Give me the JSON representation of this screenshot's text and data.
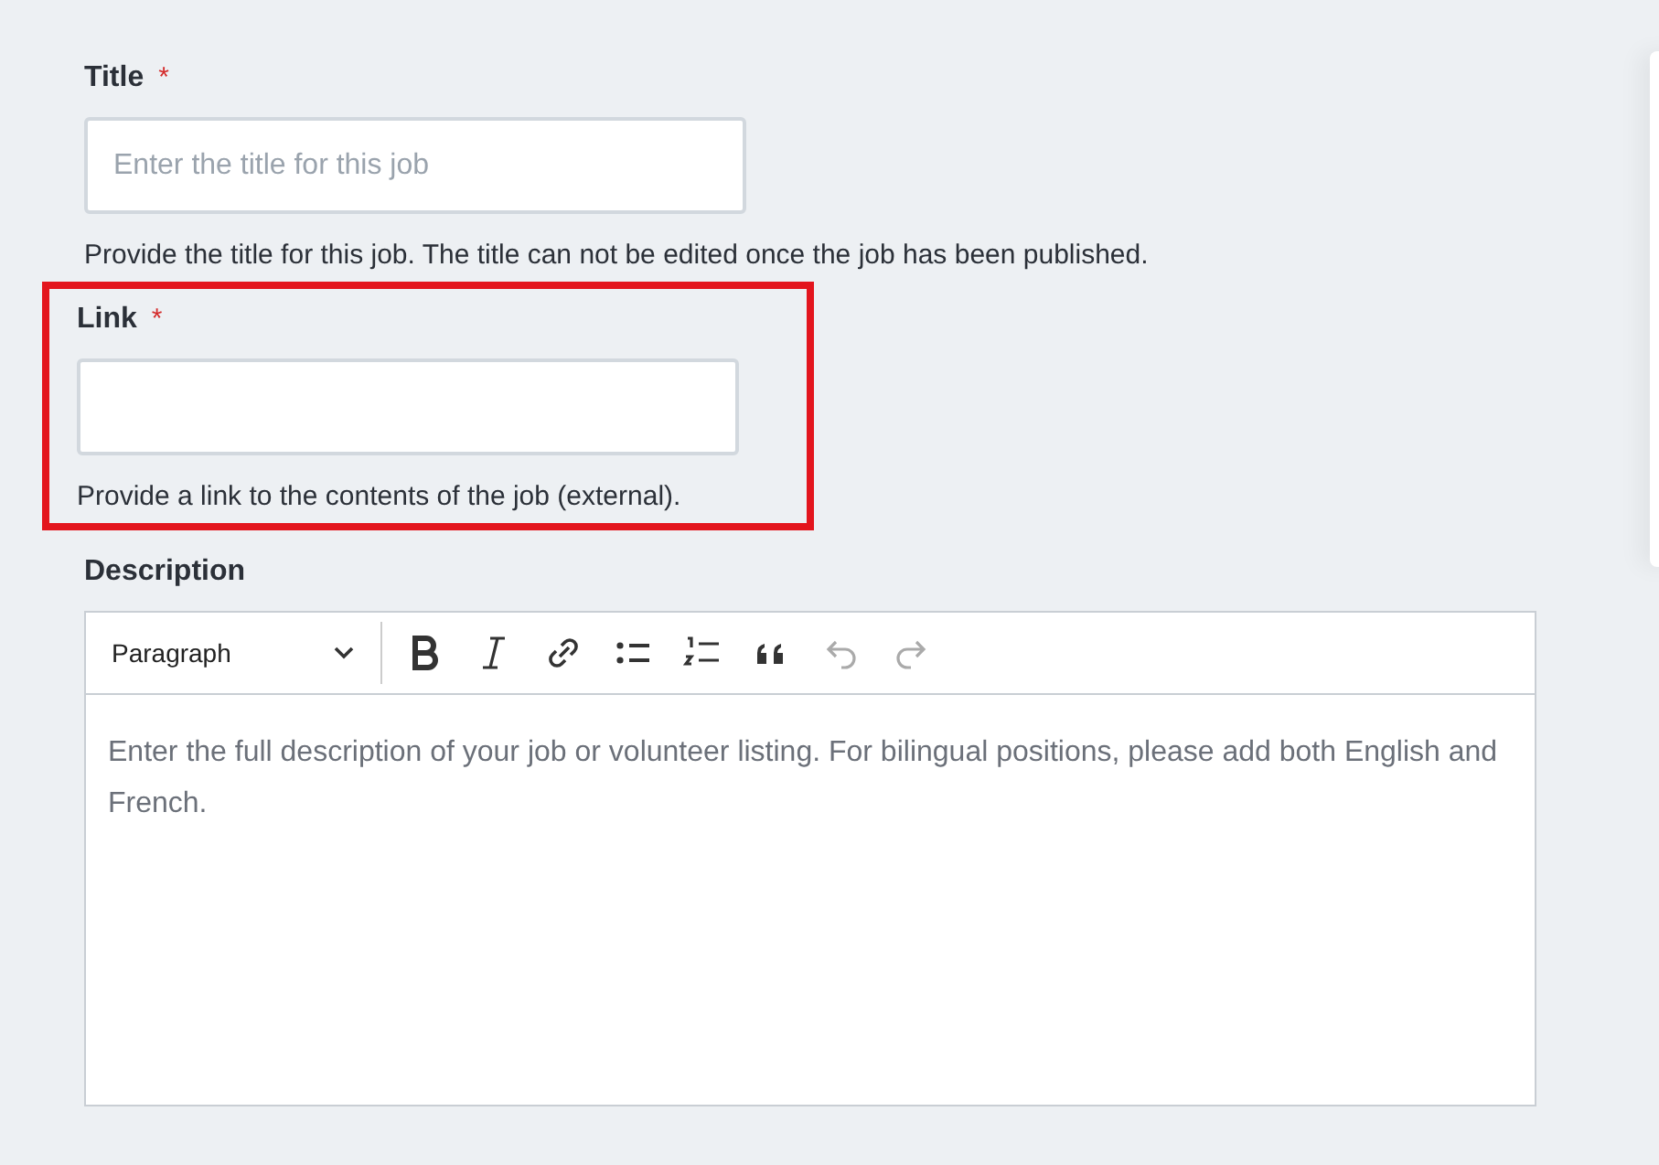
{
  "fields": [
    {
      "label": "Title",
      "required": true,
      "placeholder": "Enter the title for this job",
      "help": "Provide the title for this job. The title can not be edited once the job has been published.",
      "highlighted": false
    },
    {
      "label": "Link",
      "required": true,
      "help": "Provide a link to the contents of the job (external).",
      "highlighted": true
    }
  ],
  "required_mark": "*",
  "description": {
    "label": "Description",
    "format": "Paragraph",
    "tools": [
      {
        "kind": "bold",
        "disabled": false
      },
      {
        "kind": "italic",
        "disabled": false
      },
      {
        "kind": "link",
        "disabled": false
      },
      {
        "kind": "bullets",
        "disabled": false
      },
      {
        "kind": "numbers",
        "disabled": false
      },
      {
        "kind": "quote",
        "disabled": false
      },
      {
        "kind": "undo",
        "disabled": true
      },
      {
        "kind": "redo",
        "disabled": true
      }
    ],
    "placeholder": "Enter the full description of your job or volunteer listing. For bilingual positions, please add both English and French."
  }
}
